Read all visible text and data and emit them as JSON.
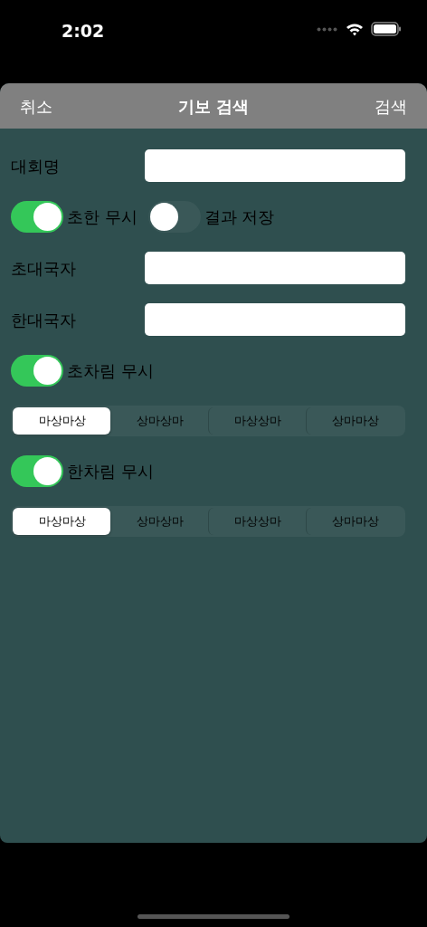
{
  "status_bar": {
    "time": "2:02"
  },
  "nav": {
    "cancel": "취소",
    "title": "기보 검색",
    "search": "검색"
  },
  "rows": [
    {
      "kind": "field",
      "label": "대회명"
    },
    {
      "kind": "toggles",
      "toggles": [
        {
          "label": "초한 무시",
          "on": true
        },
        {
          "label": "결과 저장",
          "on": false
        }
      ]
    },
    {
      "kind": "field",
      "label": "초대국자"
    },
    {
      "kind": "field",
      "label": "한대국자"
    },
    {
      "kind": "toggles",
      "toggles": [
        {
          "label": "초차림 무시",
          "on": true
        }
      ]
    },
    {
      "kind": "segmented",
      "segments": [
        {
          "label": "마상마상",
          "selected": true
        },
        {
          "label": "상마상마",
          "selected": false
        },
        {
          "label": "마상상마",
          "selected": false
        },
        {
          "label": "상마마상",
          "selected": false
        }
      ]
    },
    {
      "kind": "toggles",
      "toggles": [
        {
          "label": "한차림 무시",
          "on": true
        }
      ]
    },
    {
      "kind": "segmented",
      "segments": [
        {
          "label": "마상마상",
          "selected": true
        },
        {
          "label": "상마상마",
          "selected": false
        },
        {
          "label": "마상상마",
          "selected": false
        },
        {
          "label": "상마마상",
          "selected": false
        }
      ]
    }
  ]
}
